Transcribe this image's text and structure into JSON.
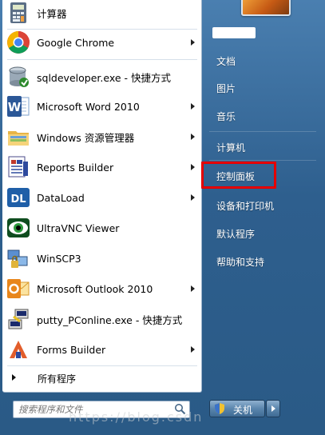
{
  "programs": [
    {
      "label": "计算器",
      "icon": "calculator-icon",
      "has_arrow": false
    },
    {
      "label": "Google Chrome",
      "icon": "chrome-icon",
      "has_arrow": true
    },
    {
      "label": "sqldeveloper.exe - 快捷方式",
      "icon": "sqldeveloper-icon",
      "has_arrow": false
    },
    {
      "label": "Microsoft Word 2010",
      "icon": "word-icon",
      "has_arrow": true
    },
    {
      "label": "Windows 资源管理器",
      "icon": "explorer-icon",
      "has_arrow": true
    },
    {
      "label": "Reports Builder",
      "icon": "reports-builder-icon",
      "has_arrow": true
    },
    {
      "label": "DataLoad",
      "icon": "dataload-icon",
      "has_arrow": true
    },
    {
      "label": "UltraVNC Viewer",
      "icon": "ultravnc-icon",
      "has_arrow": false
    },
    {
      "label": "WinSCP3",
      "icon": "winscp-icon",
      "has_arrow": false
    },
    {
      "label": "Microsoft Outlook 2010",
      "icon": "outlook-icon",
      "has_arrow": true
    },
    {
      "label": "putty_PConline.exe - 快捷方式",
      "icon": "putty-icon",
      "has_arrow": false
    },
    {
      "label": "Forms Builder",
      "icon": "forms-builder-icon",
      "has_arrow": true
    }
  ],
  "all_programs": "所有程序",
  "search": {
    "placeholder": "搜索程序和文件"
  },
  "right_items": [
    {
      "label": "文档"
    },
    {
      "label": "图片"
    },
    {
      "label": "音乐"
    },
    {
      "label": "计算机"
    },
    {
      "label": "控制面板",
      "highlighted": true
    },
    {
      "label": "设备和打印机"
    },
    {
      "label": "默认程序"
    },
    {
      "label": "帮助和支持"
    }
  ],
  "shutdown": {
    "label": "关机"
  },
  "watermark": "https://blog.csdn",
  "colors": {
    "highlight": "#e50000",
    "panel": "#2e5f8e"
  }
}
